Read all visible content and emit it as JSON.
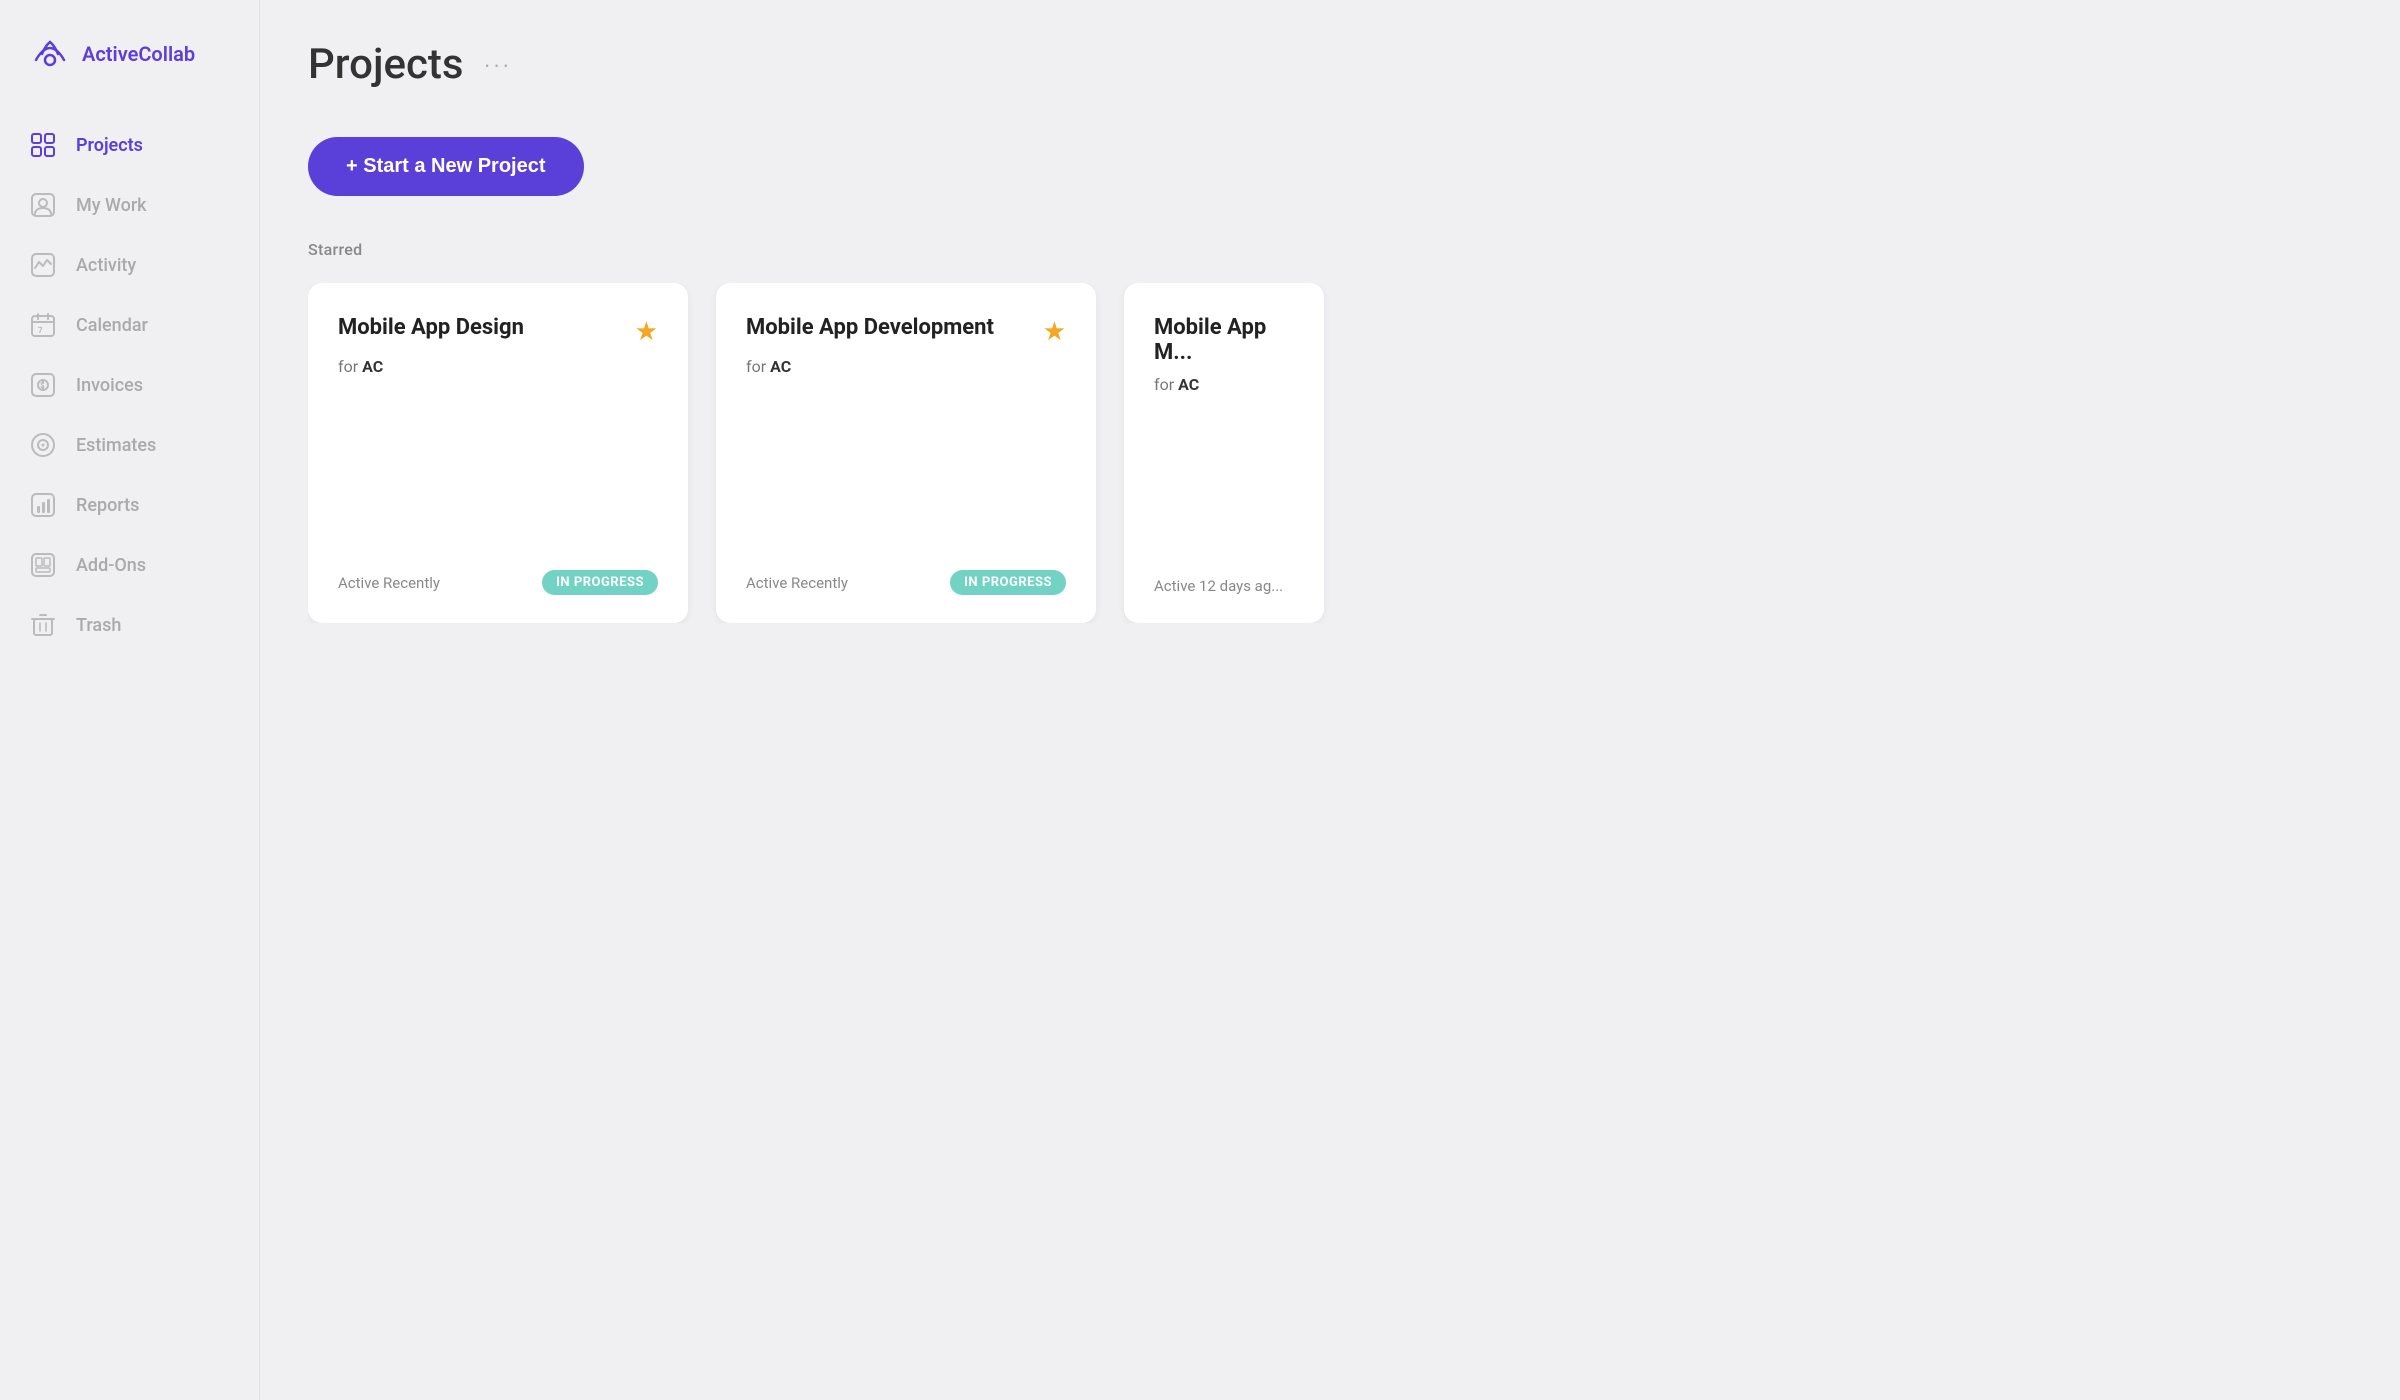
{
  "app": {
    "name": "ActiveCollab"
  },
  "sidebar": {
    "nav_items": [
      {
        "id": "projects",
        "label": "Projects",
        "active": true
      },
      {
        "id": "my-work",
        "label": "My Work",
        "active": false
      },
      {
        "id": "activity",
        "label": "Activity",
        "active": false
      },
      {
        "id": "calendar",
        "label": "Calendar",
        "active": false
      },
      {
        "id": "invoices",
        "label": "Invoices",
        "active": false
      },
      {
        "id": "estimates",
        "label": "Estimates",
        "active": false
      },
      {
        "id": "reports",
        "label": "Reports",
        "active": false
      },
      {
        "id": "add-ons",
        "label": "Add-Ons",
        "active": false
      },
      {
        "id": "trash",
        "label": "Trash",
        "active": false
      }
    ]
  },
  "main": {
    "page_title": "Projects",
    "more_icon": "···",
    "new_project_button": "+ Start a New Project",
    "starred_section_label": "Starred",
    "cards": [
      {
        "title": "Mobile App Design",
        "client_prefix": "for",
        "client": "AC",
        "starred": true,
        "activity": "Active Recently",
        "status": "IN PROGRESS"
      },
      {
        "title": "Mobile App Development",
        "client_prefix": "for",
        "client": "AC",
        "starred": true,
        "activity": "Active Recently",
        "status": "IN PROGRESS"
      },
      {
        "title": "Mobile App M...",
        "client_prefix": "for",
        "client": "AC",
        "starred": false,
        "activity": "Active 12 days ag...",
        "status": ""
      }
    ]
  }
}
